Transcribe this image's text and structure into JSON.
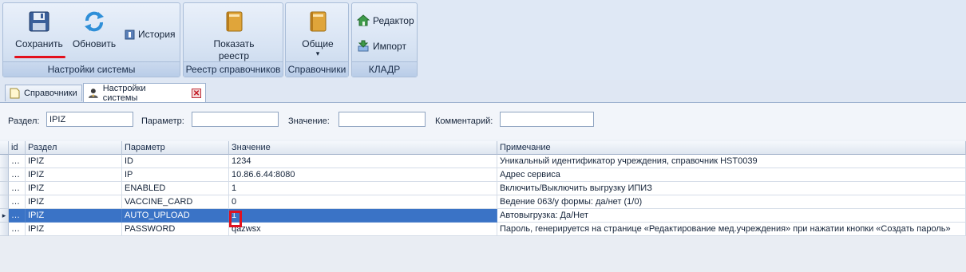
{
  "ribbon": {
    "groups": [
      {
        "label": "Настройки системы"
      },
      {
        "label": "Реестр справочников"
      },
      {
        "label": "Справочники"
      },
      {
        "label": "КЛАДР"
      }
    ],
    "buttons": {
      "save": "Сохранить",
      "refresh": "Обновить",
      "history": "История",
      "show_registry_line1": "Показать",
      "show_registry_line2": "реестр",
      "common": "Общие",
      "common_arrow": "▾",
      "editor": "Редактор",
      "import": "Импорт"
    },
    "colors": {
      "accent_red": "#e3101c"
    }
  },
  "tabs": [
    {
      "label": "Справочники",
      "icon": "document-icon",
      "active": false
    },
    {
      "label": "Настройки системы",
      "icon": "user-settings-icon",
      "active": true,
      "close": "✕"
    }
  ],
  "filter": {
    "section_label": "Раздел:",
    "section_value": "IPIZ",
    "param_label": "Параметр:",
    "param_value": "",
    "value_label": "Значение:",
    "value_value": "",
    "comment_label": "Комментарий:",
    "comment_value": ""
  },
  "grid": {
    "columns": [
      "id",
      "Раздел",
      "Параметр",
      "Значение",
      "Примечание"
    ],
    "rows": [
      {
        "marker": "",
        "id": "…",
        "section": "IPIZ",
        "param": "ID",
        "value": "1234",
        "note": "Уникальный идентификатор учреждения, справочник HST0039"
      },
      {
        "marker": "",
        "id": "…",
        "section": "IPIZ",
        "param": "IP",
        "value": "10.86.6.44:8080",
        "note": "Адрес сервиса"
      },
      {
        "marker": "",
        "id": "…",
        "section": "IPIZ",
        "param": "ENABLED",
        "value": "1",
        "note": "Включить/Выключить выгрузку ИПИЗ"
      },
      {
        "marker": "",
        "id": "…",
        "section": "IPIZ",
        "param": "VACCINE_CARD",
        "value": "0",
        "note": "Ведение 063/у формы: да/нет (1/0)"
      },
      {
        "marker": "▸",
        "id": "…",
        "section": "IPIZ",
        "param": "AUTO_UPLOAD",
        "value": "1",
        "note": "Автовыгрузка: Да/Нет",
        "selected": true
      },
      {
        "marker": "",
        "id": "…",
        "section": "IPIZ",
        "param": "PASSWORD",
        "value": "qazwsx",
        "note": "Пароль, генерируется на странице «Редактирование мед.учреждения» при нажатии кнопки «Создать пароль»"
      }
    ],
    "colors": {
      "selection": "#3a73c6",
      "highlight": "#e01221"
    }
  }
}
